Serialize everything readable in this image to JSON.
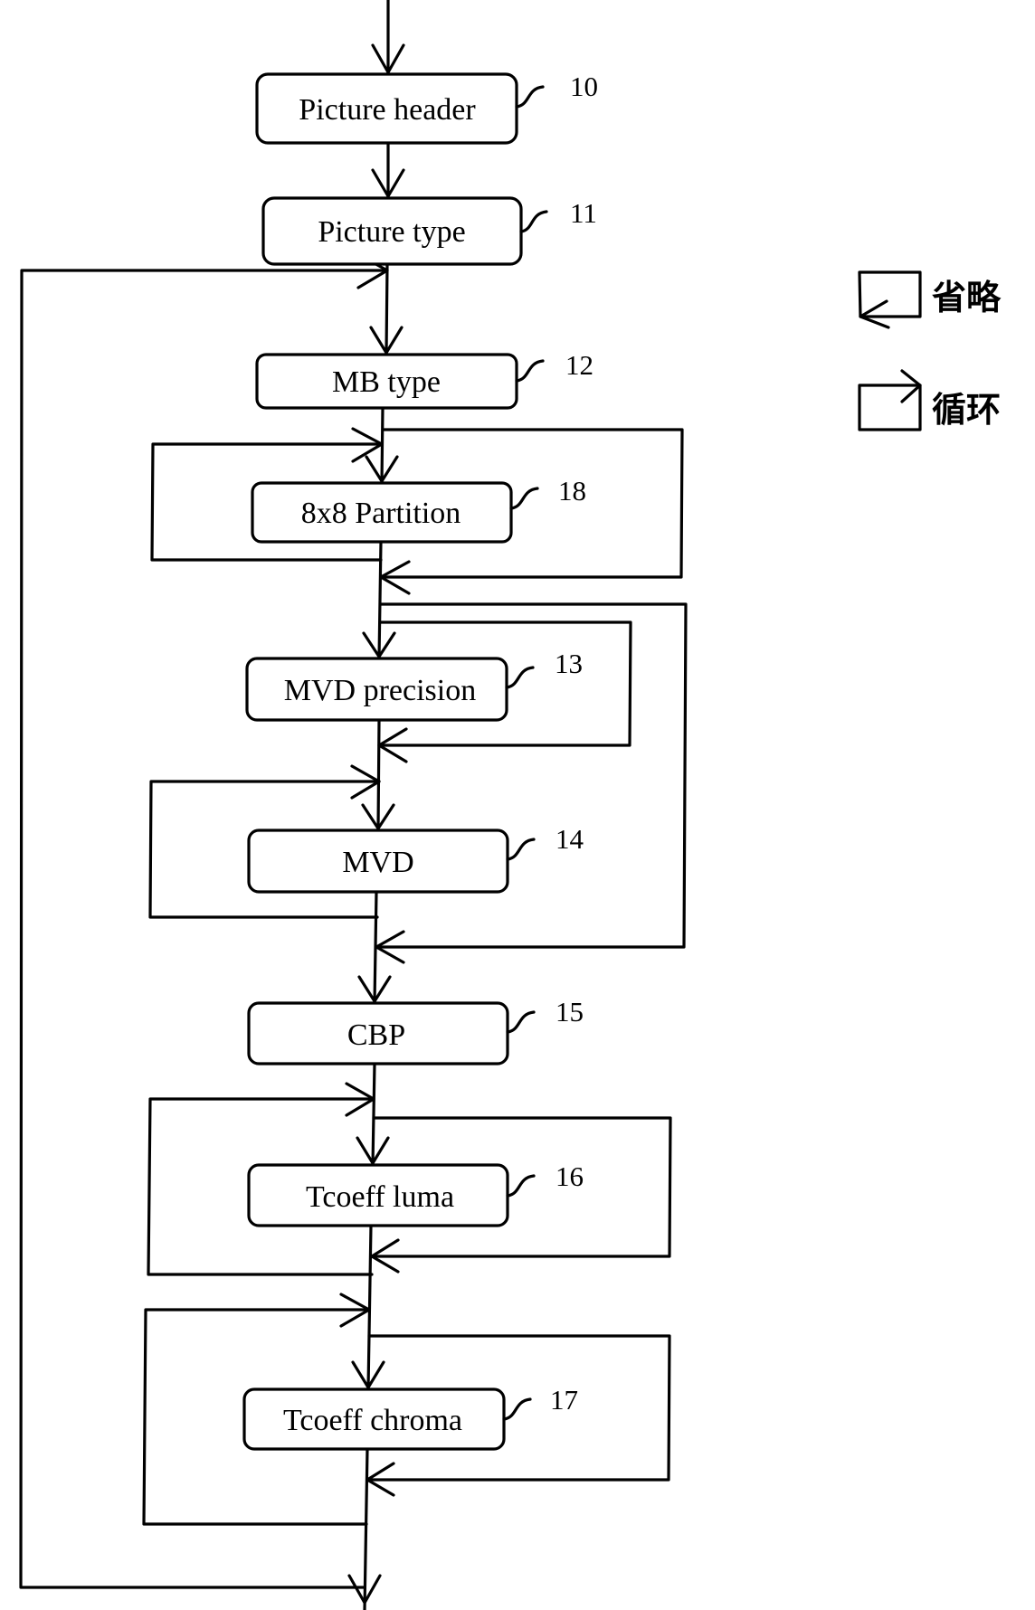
{
  "diagram": {
    "type": "flowchart",
    "blocks": [
      {
        "id": "10",
        "label": "Picture header"
      },
      {
        "id": "11",
        "label": "Picture type"
      },
      {
        "id": "12",
        "label": "MB type"
      },
      {
        "id": "18",
        "label": "8x8 Partition"
      },
      {
        "id": "13",
        "label": "MVD precision"
      },
      {
        "id": "14",
        "label": "MVD"
      },
      {
        "id": "15",
        "label": "CBP"
      },
      {
        "id": "16",
        "label": "Tcoeff luma"
      },
      {
        "id": "17",
        "label": "Tcoeff chroma"
      }
    ],
    "legend": [
      {
        "symbol": "skip-arrow",
        "label": "省略"
      },
      {
        "symbol": "loop-arrow",
        "label": "循环"
      }
    ]
  }
}
